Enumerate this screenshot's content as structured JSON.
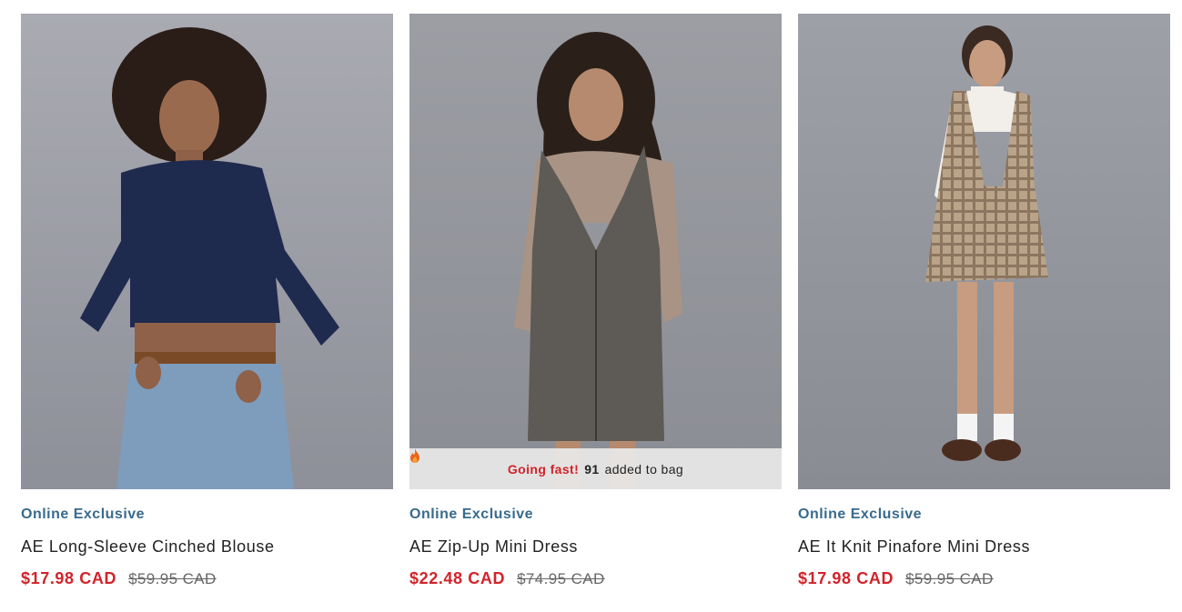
{
  "products": [
    {
      "tag": "Online Exclusive",
      "name": "AE Long-Sleeve Cinched Blouse",
      "sale_price": "$17.98 CAD",
      "original_price": "$59.95 CAD",
      "image_icon": "product-photo-navy-blouse"
    },
    {
      "tag": "Online Exclusive",
      "name": "AE Zip-Up Mini Dress",
      "sale_price": "$22.48 CAD",
      "original_price": "$74.95 CAD",
      "image_icon": "product-photo-herringbone-dress",
      "badge": {
        "icon": "flame-icon",
        "hot_text": "Going fast!",
        "count": "91",
        "suffix": "added to bag"
      }
    },
    {
      "tag": "Online Exclusive",
      "name": "AE It Knit Pinafore Mini Dress",
      "sale_price": "$17.98 CAD",
      "original_price": "$59.95 CAD",
      "image_icon": "product-photo-plaid-pinafore"
    }
  ],
  "colors": {
    "tag": "#386b8d",
    "sale": "#d2232a",
    "original": "#666666",
    "badge_bg": "#e8e8e8"
  }
}
